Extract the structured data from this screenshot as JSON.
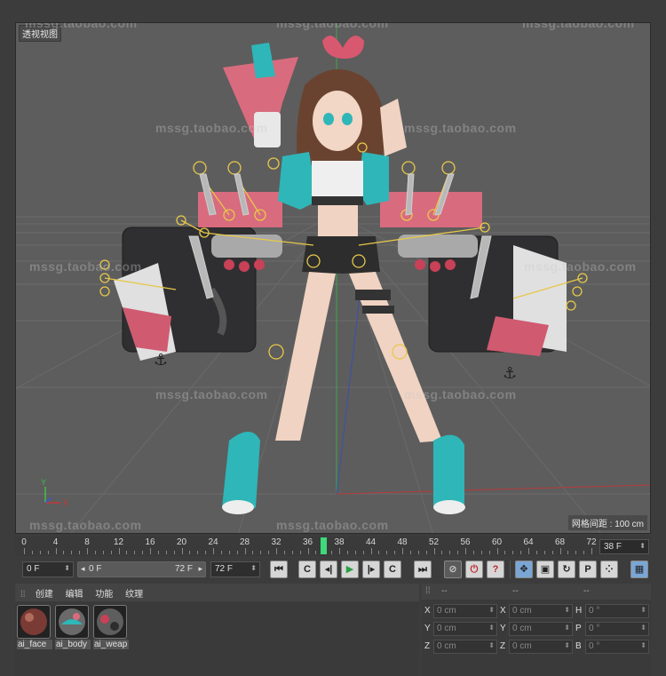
{
  "viewport": {
    "label": "透视视图",
    "grid_spacing": "网格间距 : 100 cm",
    "watermark": "mssg.taobao.com",
    "axis_labels": {
      "y": "Y",
      "x": "X"
    }
  },
  "timeline": {
    "ticks": [
      "0",
      "4",
      "8",
      "12",
      "16",
      "20",
      "24",
      "28",
      "32",
      "36",
      "38",
      "44",
      "48",
      "52",
      "56",
      "60",
      "64",
      "68",
      "72"
    ],
    "current_frame_label": "38",
    "current_frame_field": "38 F",
    "playhead_color": "#3fd97a"
  },
  "transport": {
    "start_field": "0 F",
    "range_start": "0 F",
    "range_end": "72 F",
    "end_field": "72 F",
    "buttons": {
      "goto_start": "⏮",
      "prev_key": "C",
      "prev_frame": "◂|",
      "play": "▶",
      "next_frame": "|▸",
      "next_key": "C",
      "goto_end": "⏭",
      "record_keys": "⊘",
      "autokey": "⏻",
      "help": "?",
      "move": "✥",
      "scale": "▣",
      "rotate": "↻",
      "param": "P",
      "points": "⁘",
      "film": "▦"
    }
  },
  "materials": {
    "menu": [
      "创建",
      "编辑",
      "功能",
      "纹理"
    ],
    "items": [
      "ai_face",
      "ai_body",
      "ai_weap"
    ]
  },
  "coordinates": {
    "headers": [
      "--",
      "--",
      "--"
    ],
    "rows": [
      {
        "a": "X",
        "av": "0 cm",
        "b": "X",
        "bv": "0 cm",
        "c": "H",
        "cv": "0 °"
      },
      {
        "a": "Y",
        "av": "0 cm",
        "b": "Y",
        "bv": "0 cm",
        "c": "P",
        "cv": "0 °"
      },
      {
        "a": "Z",
        "av": "0 cm",
        "b": "Z",
        "bv": "0 cm",
        "c": "B",
        "cv": "0 °"
      }
    ]
  },
  "colors": {
    "accent_pink": "#e0586f",
    "accent_teal": "#2fb6b8",
    "rig_yellow": "#e6c84a"
  }
}
